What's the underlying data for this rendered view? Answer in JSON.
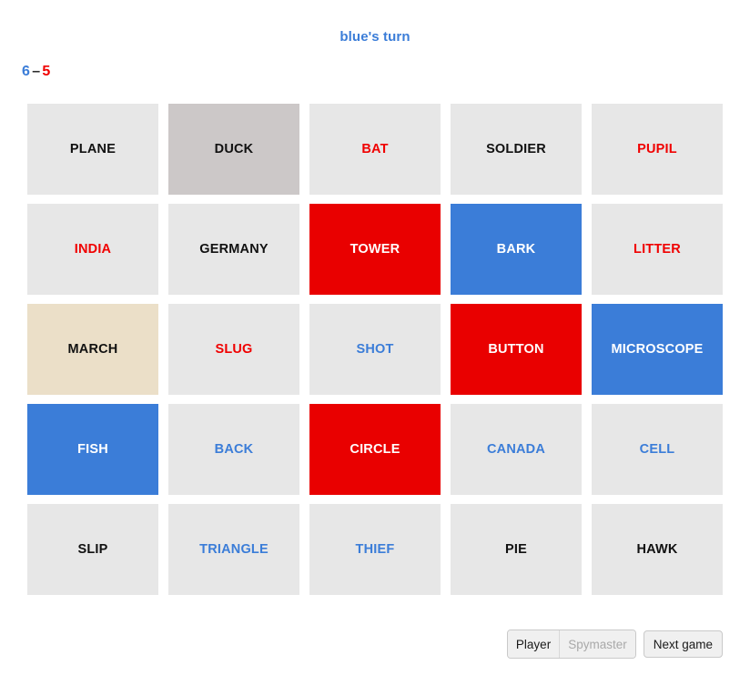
{
  "header": {
    "turn_text": "blue's turn",
    "turn_color": "#3b7dd8"
  },
  "scoreboard": {
    "blue_remaining": "6",
    "separator": "–",
    "red_remaining": "5"
  },
  "palette": {
    "red": "#e90000",
    "blue": "#3b7dd8",
    "bystander": "#ebdfc8",
    "assassin": "#ccc8c8",
    "hidden": "#e7e7e7",
    "red_text": "#f00000",
    "blue_text": "#3b7dd8",
    "neutral_text": "#111111"
  },
  "board": {
    "rows": 5,
    "columns": 5,
    "cards": [
      {
        "word": "PLANE",
        "state": "hidden",
        "hint": "neutral"
      },
      {
        "word": "DUCK",
        "state": "assassin",
        "hint": "neutral"
      },
      {
        "word": "BAT",
        "state": "hidden",
        "hint": "red"
      },
      {
        "word": "SOLDIER",
        "state": "hidden",
        "hint": "neutral"
      },
      {
        "word": "PUPIL",
        "state": "hidden",
        "hint": "red"
      },
      {
        "word": "INDIA",
        "state": "hidden",
        "hint": "red"
      },
      {
        "word": "GERMANY",
        "state": "hidden",
        "hint": "neutral"
      },
      {
        "word": "TOWER",
        "state": "red",
        "hint": "red"
      },
      {
        "word": "BARK",
        "state": "blue",
        "hint": "blue"
      },
      {
        "word": "LITTER",
        "state": "hidden",
        "hint": "red"
      },
      {
        "word": "MARCH",
        "state": "bystander",
        "hint": "neutral"
      },
      {
        "word": "SLUG",
        "state": "hidden",
        "hint": "red"
      },
      {
        "word": "SHOT",
        "state": "hidden",
        "hint": "blue"
      },
      {
        "word": "BUTTON",
        "state": "red",
        "hint": "red"
      },
      {
        "word": "MICROSCOPE",
        "state": "blue",
        "hint": "blue"
      },
      {
        "word": "FISH",
        "state": "blue",
        "hint": "blue"
      },
      {
        "word": "BACK",
        "state": "hidden",
        "hint": "blue"
      },
      {
        "word": "CIRCLE",
        "state": "red",
        "hint": "red"
      },
      {
        "word": "CANADA",
        "state": "hidden",
        "hint": "blue"
      },
      {
        "word": "CELL",
        "state": "hidden",
        "hint": "blue"
      },
      {
        "word": "SLIP",
        "state": "hidden",
        "hint": "neutral"
      },
      {
        "word": "TRIANGLE",
        "state": "hidden",
        "hint": "blue"
      },
      {
        "word": "THIEF",
        "state": "hidden",
        "hint": "blue"
      },
      {
        "word": "PIE",
        "state": "hidden",
        "hint": "neutral"
      },
      {
        "word": "HAWK",
        "state": "hidden",
        "hint": "neutral"
      }
    ]
  },
  "controls": {
    "role_toggle": {
      "player_label": "Player",
      "spymaster_label": "Spymaster",
      "selected": "Player"
    },
    "next_game_label": "Next game"
  }
}
